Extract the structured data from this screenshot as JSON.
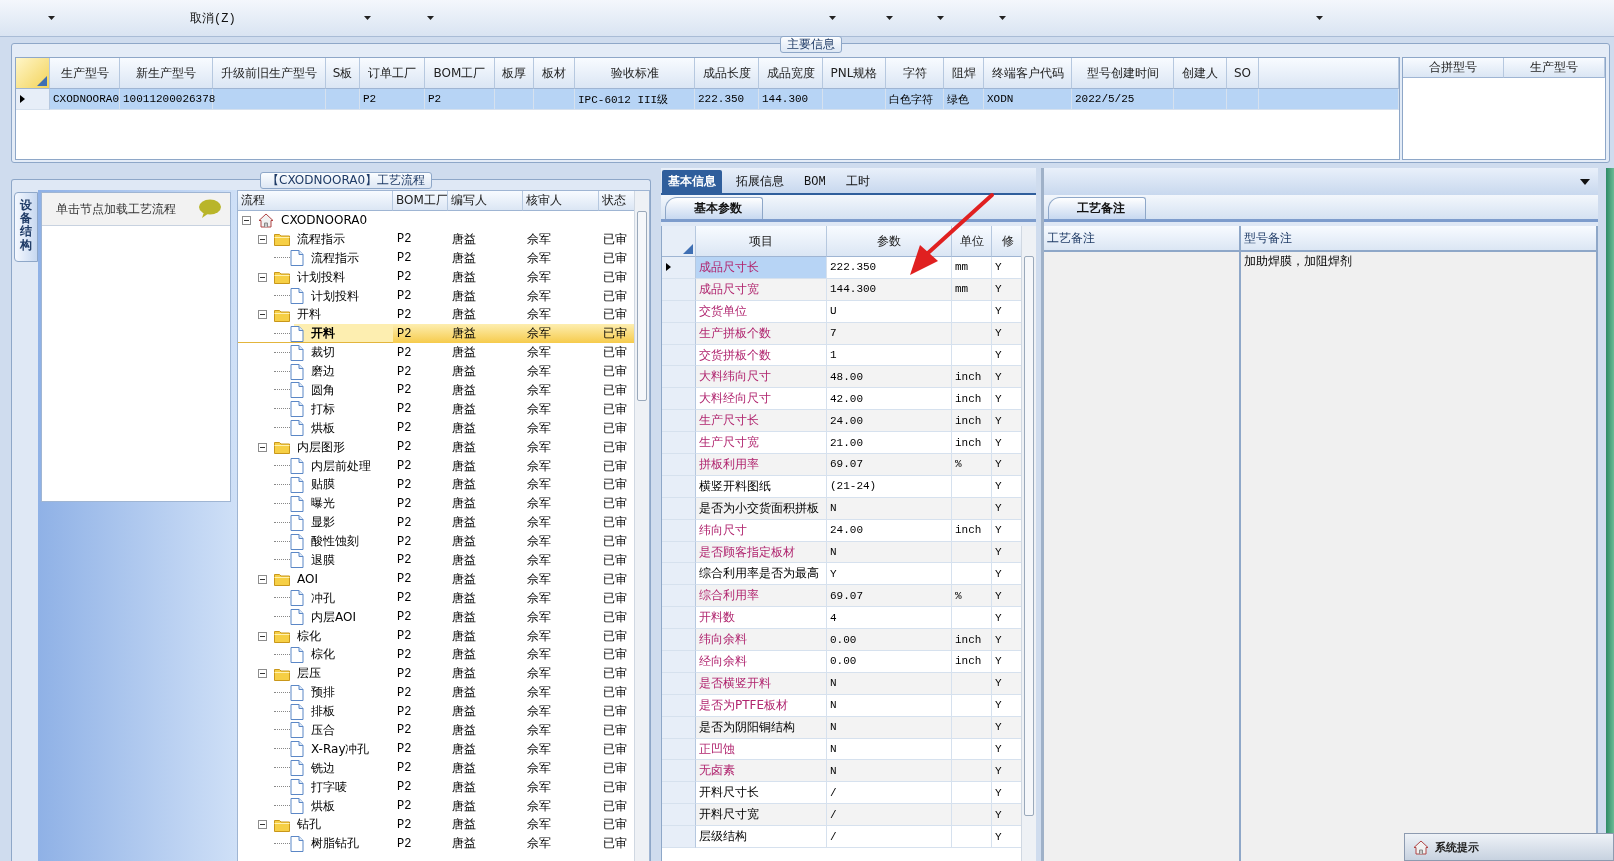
{
  "toolbar": [
    {
      "kind": "dropdown"
    },
    {
      "kind": "button",
      "label": "取消(Z)"
    },
    {
      "kind": "dropdown"
    },
    {
      "kind": "dropdown"
    },
    {
      "kind": "dropdown"
    },
    {
      "kind": "dropdown"
    },
    {
      "kind": "dropdown"
    },
    {
      "kind": "dropdown"
    },
    {
      "kind": "dropdown"
    }
  ],
  "main_info": {
    "title": "主要信息",
    "columns": [
      "生产型号",
      "新生产型号",
      "升级前旧生产型号",
      "S板",
      "订单工厂",
      "BOM工厂",
      "板厚",
      "板材",
      "验收标准",
      "成品长度",
      "成品宽度",
      "PNL规格",
      "字符",
      "阻焊",
      "终端客户代码",
      "型号创建时间",
      "创建人",
      "SO"
    ],
    "rows": [
      {
        "selected": true,
        "cells": [
          "CXODNOORA0",
          "10011200026378",
          null,
          null,
          "P2",
          "P2",
          null,
          null,
          "IPC-6012 III级",
          "222.350",
          "144.300",
          null,
          "白色字符",
          "绿色",
          "XODN",
          "2022/5/25",
          null,
          null
        ]
      }
    ],
    "merge_table": {
      "columns": [
        "合拼型号",
        "生产型号"
      ]
    }
  },
  "process": {
    "title": "【CXODNOORA0】工艺流程",
    "side_tab": "设备结构",
    "side_panel_title": "单击节点加载工艺流程",
    "columns": [
      "流程",
      "BOM工厂",
      "编写人",
      "核审人",
      "状态"
    ],
    "tree": [
      {
        "label": "CXODNOORA0",
        "expanded": true,
        "selected": false,
        "children": [
          {
            "label": "流程指示",
            "bom": "P2",
            "writer": "唐益",
            "reviewer": "佘军",
            "status": "已审",
            "expanded": true,
            "selected": false,
            "children": [
              {
                "label": "流程指示",
                "bom": "P2",
                "writer": "唐益",
                "reviewer": "佘军",
                "status": "已审",
                "selected": false
              }
            ]
          },
          {
            "label": "计划投料",
            "bom": "P2",
            "writer": "唐益",
            "reviewer": "佘军",
            "status": "已审",
            "expanded": true,
            "selected": false,
            "children": [
              {
                "label": "计划投料",
                "bom": "P2",
                "writer": "唐益",
                "reviewer": "佘军",
                "status": "已审",
                "selected": false
              }
            ]
          },
          {
            "label": "开料",
            "bom": "P2",
            "writer": "唐益",
            "reviewer": "佘军",
            "status": "已审",
            "expanded": true,
            "selected": false,
            "children": [
              {
                "label": "开料",
                "bom": "P2",
                "writer": "唐益",
                "reviewer": "佘军",
                "status": "已审",
                "selected": true
              },
              {
                "label": "裁切",
                "bom": "P2",
                "writer": "唐益",
                "reviewer": "佘军",
                "status": "已审",
                "selected": false
              },
              {
                "label": "磨边",
                "bom": "P2",
                "writer": "唐益",
                "reviewer": "佘军",
                "status": "已审",
                "selected": false
              },
              {
                "label": "圆角",
                "bom": "P2",
                "writer": "唐益",
                "reviewer": "佘军",
                "status": "已审",
                "selected": false
              },
              {
                "label": "打标",
                "bom": "P2",
                "writer": "唐益",
                "reviewer": "佘军",
                "status": "已审",
                "selected": false
              },
              {
                "label": "烘板",
                "bom": "P2",
                "writer": "唐益",
                "reviewer": "佘军",
                "status": "已审",
                "selected": false
              }
            ]
          },
          {
            "label": "内层图形",
            "bom": "P2",
            "writer": "唐益",
            "reviewer": "佘军",
            "status": "已审",
            "expanded": true,
            "selected": false,
            "children": [
              {
                "label": "内层前处理",
                "bom": "P2",
                "writer": "唐益",
                "reviewer": "佘军",
                "status": "已审",
                "selected": false
              },
              {
                "label": "贴膜",
                "bom": "P2",
                "writer": "唐益",
                "reviewer": "佘军",
                "status": "已审",
                "selected": false
              },
              {
                "label": "曝光",
                "bom": "P2",
                "writer": "唐益",
                "reviewer": "佘军",
                "status": "已审",
                "selected": false
              },
              {
                "label": "显影",
                "bom": "P2",
                "writer": "唐益",
                "reviewer": "佘军",
                "status": "已审",
                "selected": false
              },
              {
                "label": "酸性蚀刻",
                "bom": "P2",
                "writer": "唐益",
                "reviewer": "佘军",
                "status": "已审",
                "selected": false
              },
              {
                "label": "退膜",
                "bom": "P2",
                "writer": "唐益",
                "reviewer": "佘军",
                "status": "已审",
                "selected": false
              }
            ]
          },
          {
            "label": "AOI",
            "bom": "P2",
            "writer": "唐益",
            "reviewer": "佘军",
            "status": "已审",
            "expanded": true,
            "selected": false,
            "children": [
              {
                "label": "冲孔",
                "bom": "P2",
                "writer": "唐益",
                "reviewer": "佘军",
                "status": "已审",
                "selected": false
              },
              {
                "label": "内层AOI",
                "bom": "P2",
                "writer": "唐益",
                "reviewer": "佘军",
                "status": "已审",
                "selected": false
              }
            ]
          },
          {
            "label": "棕化",
            "bom": "P2",
            "writer": "唐益",
            "reviewer": "佘军",
            "status": "已审",
            "expanded": true,
            "selected": false,
            "children": [
              {
                "label": "棕化",
                "bom": "P2",
                "writer": "唐益",
                "reviewer": "佘军",
                "status": "已审",
                "selected": false
              }
            ]
          },
          {
            "label": "层压",
            "bom": "P2",
            "writer": "唐益",
            "reviewer": "佘军",
            "status": "已审",
            "expanded": true,
            "selected": false,
            "children": [
              {
                "label": "预排",
                "bom": "P2",
                "writer": "唐益",
                "reviewer": "佘军",
                "status": "已审",
                "selected": false
              },
              {
                "label": "排板",
                "bom": "P2",
                "writer": "唐益",
                "reviewer": "佘军",
                "status": "已审",
                "selected": false
              },
              {
                "label": "压合",
                "bom": "P2",
                "writer": "唐益",
                "reviewer": "佘军",
                "status": "已审",
                "selected": false
              },
              {
                "label": "X-Ray冲孔",
                "bom": "P2",
                "writer": "唐益",
                "reviewer": "佘军",
                "status": "已审",
                "selected": false
              },
              {
                "label": "铣边",
                "bom": "P2",
                "writer": "唐益",
                "reviewer": "佘军",
                "status": "已审",
                "selected": false
              },
              {
                "label": "打字唛",
                "bom": "P2",
                "writer": "唐益",
                "reviewer": "佘军",
                "status": "已审",
                "selected": false
              },
              {
                "label": "烘板",
                "bom": "P2",
                "writer": "唐益",
                "reviewer": "佘军",
                "status": "已审",
                "selected": false
              }
            ]
          },
          {
            "label": "钻孔",
            "bom": "P2",
            "writer": "唐益",
            "reviewer": "佘军",
            "status": "已审",
            "expanded": true,
            "selected": false,
            "children": [
              {
                "label": "树脂钻孔",
                "bom": "P2",
                "writer": "唐益",
                "reviewer": "佘军",
                "status": "已审",
                "selected": false
              }
            ]
          }
        ]
      }
    ]
  },
  "detail_tabs": [
    {
      "label": "基本信息",
      "selected": true
    },
    {
      "label": "拓展信息",
      "selected": false
    },
    {
      "label": "BOM",
      "selected": false
    },
    {
      "label": "工时",
      "selected": false
    }
  ],
  "params": {
    "tab": "基本参数",
    "columns": [
      "项目",
      "参数",
      "单位",
      "修"
    ],
    "rows": [
      {
        "kind": "required",
        "item": "成品尺寸长",
        "value": "222.350",
        "unit": "mm",
        "mod": "Y",
        "selected": true
      },
      {
        "kind": "required",
        "item": "成品尺寸宽",
        "value": "144.300",
        "unit": "mm",
        "mod": "Y",
        "selected": false
      },
      {
        "kind": "required",
        "item": "交货单位",
        "value": "U",
        "mod": "Y",
        "selected": false
      },
      {
        "kind": "required",
        "item": "生产拼板个数",
        "value": "7",
        "mod": "Y",
        "selected": false
      },
      {
        "kind": "required",
        "item": "交货拼板个数",
        "value": "1",
        "mod": "Y",
        "selected": false
      },
      {
        "kind": "required",
        "item": "大料纬向尺寸",
        "value": "48.00",
        "unit": "inch",
        "mod": "Y",
        "selected": false
      },
      {
        "kind": "required",
        "item": "大料经向尺寸",
        "value": "42.00",
        "unit": "inch",
        "mod": "Y",
        "selected": false
      },
      {
        "kind": "required",
        "item": "生产尺寸长",
        "value": "24.00",
        "unit": "inch",
        "mod": "Y",
        "selected": false
      },
      {
        "kind": "required",
        "item": "生产尺寸宽",
        "value": "21.00",
        "unit": "inch",
        "mod": "Y",
        "selected": false
      },
      {
        "kind": "required",
        "item": "拼板利用率",
        "value": "69.07",
        "unit": "%",
        "mod": "Y",
        "selected": false
      },
      {
        "kind": "normal",
        "item": "横竖开料图纸",
        "value": "(21-24)",
        "mod": "Y",
        "selected": false
      },
      {
        "kind": "normal",
        "item": "是否为小交货面积拼板",
        "value": "N",
        "mod": "Y",
        "selected": false
      },
      {
        "kind": "required",
        "item": "纬向尺寸",
        "value": "24.00",
        "unit": "inch",
        "mod": "Y",
        "selected": false
      },
      {
        "kind": "required",
        "item": "是否顾客指定板材",
        "value": "N",
        "mod": "Y",
        "selected": false
      },
      {
        "kind": "normal",
        "item": "综合利用率是否为最高",
        "value": "Y",
        "mod": "Y",
        "selected": false
      },
      {
        "kind": "required",
        "item": "综合利用率",
        "value": "69.07",
        "unit": "%",
        "mod": "Y",
        "selected": false
      },
      {
        "kind": "required",
        "item": "开料数",
        "value": "4",
        "mod": "Y",
        "selected": false
      },
      {
        "kind": "required",
        "item": "纬向余料",
        "value": "0.00",
        "unit": "inch",
        "mod": "Y",
        "selected": false
      },
      {
        "kind": "required",
        "item": "经向余料",
        "value": "0.00",
        "unit": "inch",
        "mod": "Y",
        "selected": false
      },
      {
        "kind": "required",
        "item": "是否横竖开料",
        "value": "N",
        "mod": "Y",
        "selected": false
      },
      {
        "kind": "required",
        "item": "是否为PTFE板材",
        "value": "N",
        "mod": "Y",
        "selected": false
      },
      {
        "kind": "normal",
        "item": "是否为阴阳铜结构",
        "value": "N",
        "mod": "Y",
        "selected": false
      },
      {
        "kind": "required",
        "item": "正凹蚀",
        "value": "N",
        "mod": "Y",
        "selected": false
      },
      {
        "kind": "required",
        "item": "无卤素",
        "value": "N",
        "mod": "Y",
        "selected": false
      },
      {
        "kind": "normal",
        "item": "开料尺寸长",
        "value": "/",
        "mod": "Y",
        "selected": false
      },
      {
        "kind": "normal",
        "item": "开料尺寸宽",
        "value": "/",
        "mod": "Y",
        "selected": false
      },
      {
        "kind": "normal",
        "item": "层级结构",
        "value": "/",
        "mod": "Y",
        "selected": false
      }
    ]
  },
  "remarks": {
    "tab": "工艺备注",
    "columns": [
      {
        "header": "工艺备注"
      },
      {
        "header": "型号备注",
        "text": "加助焊膜，加阻焊剂"
      }
    ]
  },
  "popup": {
    "title": "系统提示"
  }
}
